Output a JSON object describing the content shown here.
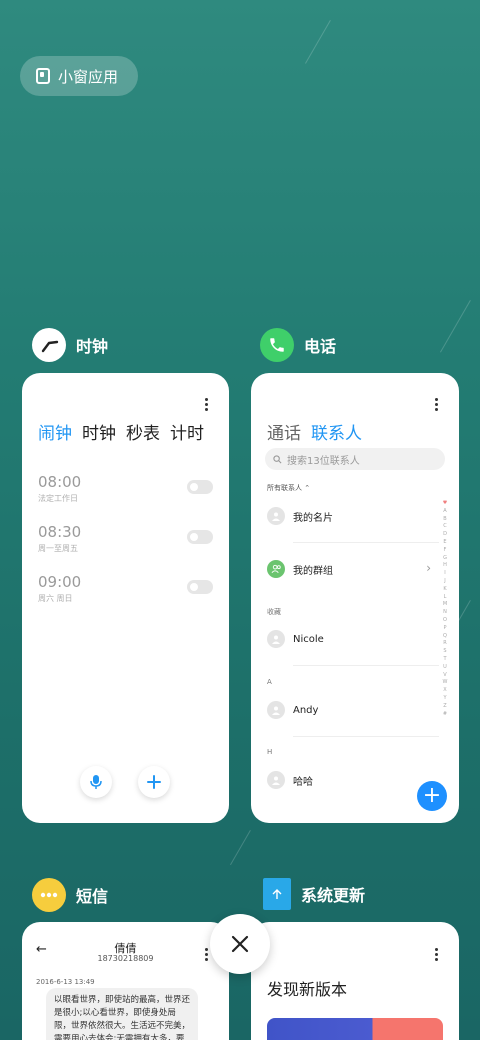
{
  "mini_window": {
    "label": "小窗应用"
  },
  "clock": {
    "app_name": "时钟",
    "tabs": [
      "闹钟",
      "时钟",
      "秒表",
      "计时"
    ],
    "alarms": [
      {
        "time": "08:00",
        "repeat": "法定工作日"
      },
      {
        "time": "08:30",
        "repeat": "周一至周五"
      },
      {
        "time": "09:00",
        "repeat": "周六 周日"
      }
    ]
  },
  "phone": {
    "app_name": "电话",
    "tabs": [
      "通话",
      "联系人"
    ],
    "search_placeholder": "搜索13位联系人",
    "all_contacts": "所有联系人",
    "my_card": "我的名片",
    "my_group": "我的群组",
    "section_fav": "收藏",
    "contact_1": "Nicole",
    "section_a": "A",
    "contact_2": "Andy",
    "section_h": "H",
    "contact_3": "哈哈",
    "index_letters": [
      "♥",
      "A",
      "B",
      "C",
      "D",
      "E",
      "F",
      "G",
      "H",
      "I",
      "J",
      "K",
      "L",
      "M",
      "N",
      "O",
      "P",
      "Q",
      "R",
      "S",
      "T",
      "U",
      "V",
      "W",
      "X",
      "Y",
      "Z",
      "#"
    ]
  },
  "sms": {
    "app_name": "短信",
    "contact_name": "倩倩",
    "contact_number": "18730218809",
    "date": "2016-6-13 13:49",
    "message": "以眼看世界，即使站的最高，世界还是很小;以心看世界，即使身处局限，世界依然很大。生活远不完美，需要用心去体会;无需拥有太多，要"
  },
  "update": {
    "app_name": "系统更新",
    "title": "发现新版本"
  },
  "colors": {
    "accent": "#2196f3",
    "phone_green": "#3fcf6a",
    "sms_yellow": "#f6cd3d",
    "update_blue": "#29a8e8"
  }
}
